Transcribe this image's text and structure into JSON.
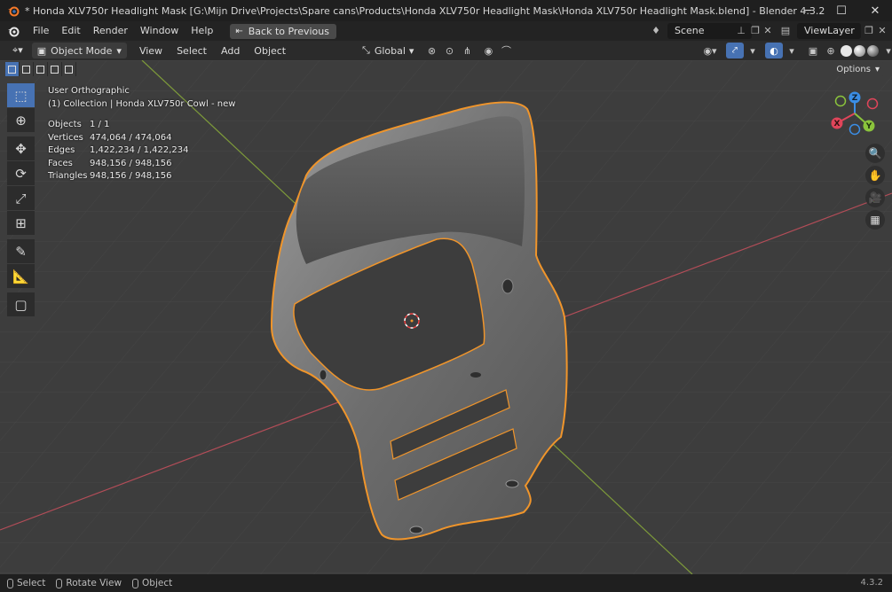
{
  "window": {
    "title": "* Honda XLV750r Headlight Mask [G:\\Mijn Drive\\Projects\\Spare cans\\Products\\Honda XLV750r Headlight Mask\\Honda XLV750r Headlight Mask.blend] - Blender 4.3.2",
    "minimize": "─",
    "maximize": "☐",
    "close": "✕"
  },
  "menubar": {
    "items": [
      "File",
      "Edit",
      "Render",
      "Window",
      "Help"
    ],
    "back_button": "Back to Previous",
    "scene_label": "Scene",
    "view_layer_label": "ViewLayer"
  },
  "header": {
    "mode": "Object Mode",
    "menus": [
      "View",
      "Select",
      "Add",
      "Object"
    ],
    "transform_orientation": "Global"
  },
  "viewport": {
    "view_name": "User Orthographic",
    "collection_line": "(1) Collection | Honda XLV750r Cowl - new",
    "stats": [
      {
        "label": "Objects",
        "value": "1 / 1"
      },
      {
        "label": "Vertices",
        "value": "474,064 / 474,064"
      },
      {
        "label": "Edges",
        "value": "1,422,234 / 1,422,234"
      },
      {
        "label": "Faces",
        "value": "948,156 / 948,156"
      },
      {
        "label": "Triangles",
        "value": "948,156 / 948,156"
      }
    ],
    "options_label": "Options",
    "gizmo": {
      "x": "X",
      "y": "Y",
      "z": "Z"
    },
    "colors": {
      "x_axis": "#e0455a",
      "y_axis": "#8bc43c",
      "z_axis": "#3b8ee6",
      "selection_outline": "#f0952b",
      "active_tool": "#4772b3"
    }
  },
  "statusbar": {
    "select": "Select",
    "rotate": "Rotate View",
    "object": "Object",
    "version": "4.3.2"
  }
}
